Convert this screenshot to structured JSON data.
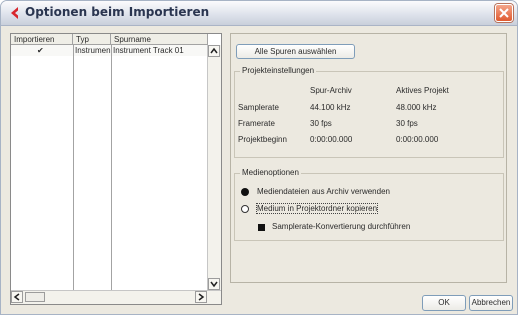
{
  "window": {
    "title": "Optionen beim Importieren"
  },
  "table": {
    "columns": [
      "Importieren",
      "Typ",
      "Spurname"
    ],
    "rows": [
      {
        "import": "✔",
        "type": "Instrumen",
        "name": "Instrument Track 01"
      }
    ]
  },
  "panel": {
    "select_all_label": "Alle Spuren auswählen",
    "project_settings": {
      "legend": "Projekteinstellungen",
      "col_archive": "Spur-Archiv",
      "col_active": "Aktives Projekt",
      "rows": [
        {
          "label": "Samplerate",
          "archive": "44.100 kHz",
          "active": "48.000 kHz"
        },
        {
          "label": "Framerate",
          "archive": "30 fps",
          "active": "30 fps"
        },
        {
          "label": "Projektbeginn",
          "archive": "0:00:00.000",
          "active": "0:00:00.000"
        }
      ]
    },
    "media_options": {
      "legend": "Medienoptionen",
      "option_use_archive": "Mediendateien aus Archiv verwenden",
      "option_copy_to_project": "Medium in Projektordner kopieren",
      "convert_samplerate": "Samplerate-Konvertierung durchführen"
    }
  },
  "buttons": {
    "ok": "OK",
    "cancel": "Abbrechen"
  },
  "colors": {
    "title_text": "#2a3550",
    "close_button": "#e05a30",
    "dialog_bg": "#ece9e0"
  }
}
